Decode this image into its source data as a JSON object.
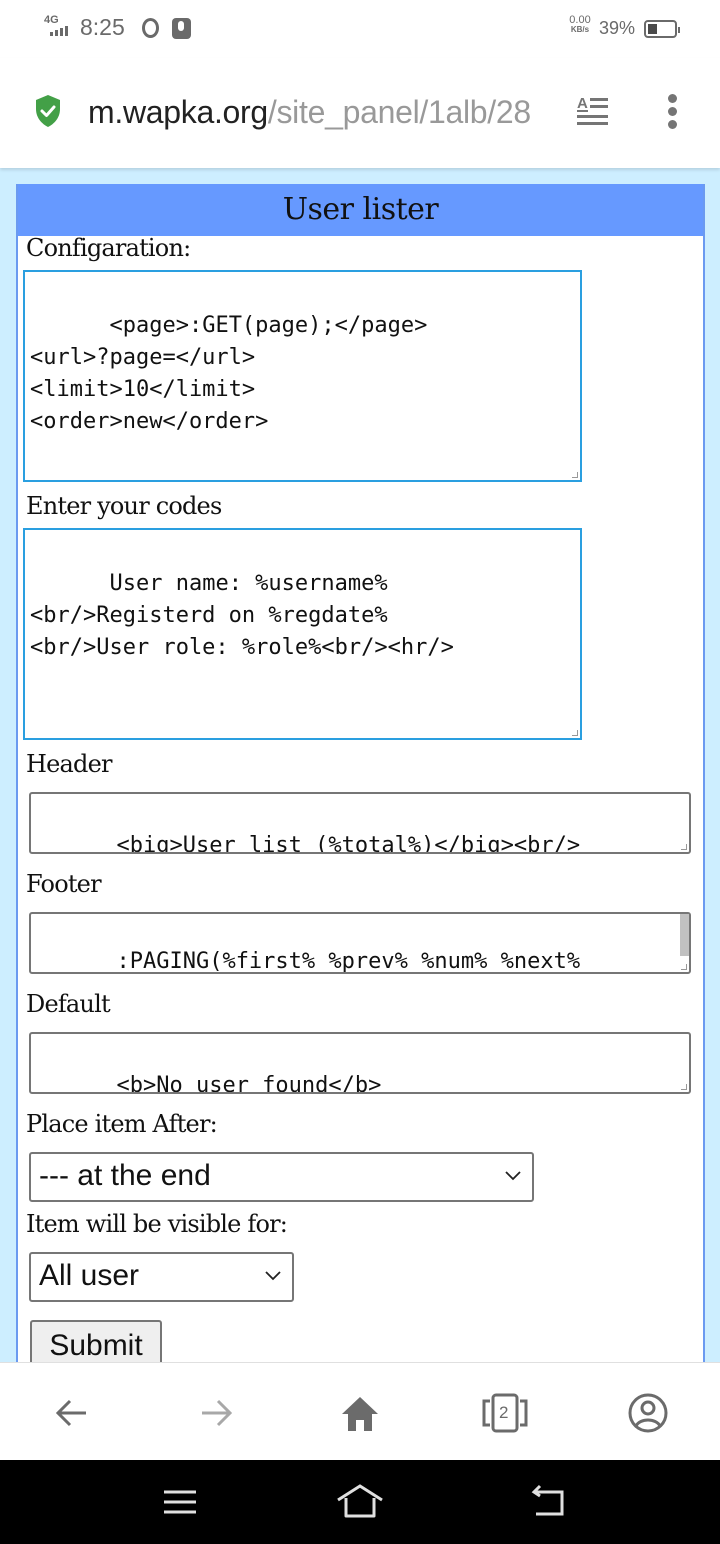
{
  "status_bar": {
    "network": "4G",
    "time": "8:25",
    "speed_value": "0.00",
    "speed_unit": "KB/s",
    "battery_percent": "39%",
    "battery_level": 0.39,
    "icons": [
      "signal-icon",
      "opera-icon",
      "microphone-icon",
      "battery-icon"
    ]
  },
  "browser": {
    "url_host": "m.wapka.org",
    "url_path": "/site_panel/1alb/28",
    "secure_icon": "shield-check-icon",
    "reader_icon": "reader-mode-icon",
    "menu_icon": "more-vert-icon",
    "colors": {
      "shield": "#43a047"
    }
  },
  "panel": {
    "title": "User lister",
    "colors": {
      "title_bg": "#6699ff",
      "page_bg": "#cdeeff",
      "focus_border": "#2a9fe0"
    },
    "configuration": {
      "label": "Configaration:",
      "value": "<page>:GET(page);</page>\n<url>?page=</url>\n<limit>10</limit>\n<order>new</order>"
    },
    "codes": {
      "label": "Enter your codes",
      "value": "User name: %username%\n<br/>Registerd on %regdate%\n<br/>User role: %role%<br/><hr/>"
    },
    "header": {
      "label": "Header",
      "value": "<big>User list (%total%)</big><br/>"
    },
    "footer": {
      "label": "Footer",
      "value": ":PAGING(%first% %prev% %num% %next%\n%last%);"
    },
    "default": {
      "label": "Default",
      "value": "<b>No user found</b>"
    },
    "place_after": {
      "label": "Place item After:",
      "selected": "--- at the end"
    },
    "visibility": {
      "label": "Item will be visible for:",
      "selected": "All user"
    },
    "submit_label": "Submit"
  },
  "bottom_nav": {
    "back": "back-arrow-icon",
    "forward": "forward-arrow-icon",
    "home": "home-icon",
    "tabs_count": "2",
    "account": "account-icon"
  },
  "system_nav": {
    "recent": "recent-apps-icon",
    "home": "system-home-icon",
    "back": "system-back-icon"
  }
}
